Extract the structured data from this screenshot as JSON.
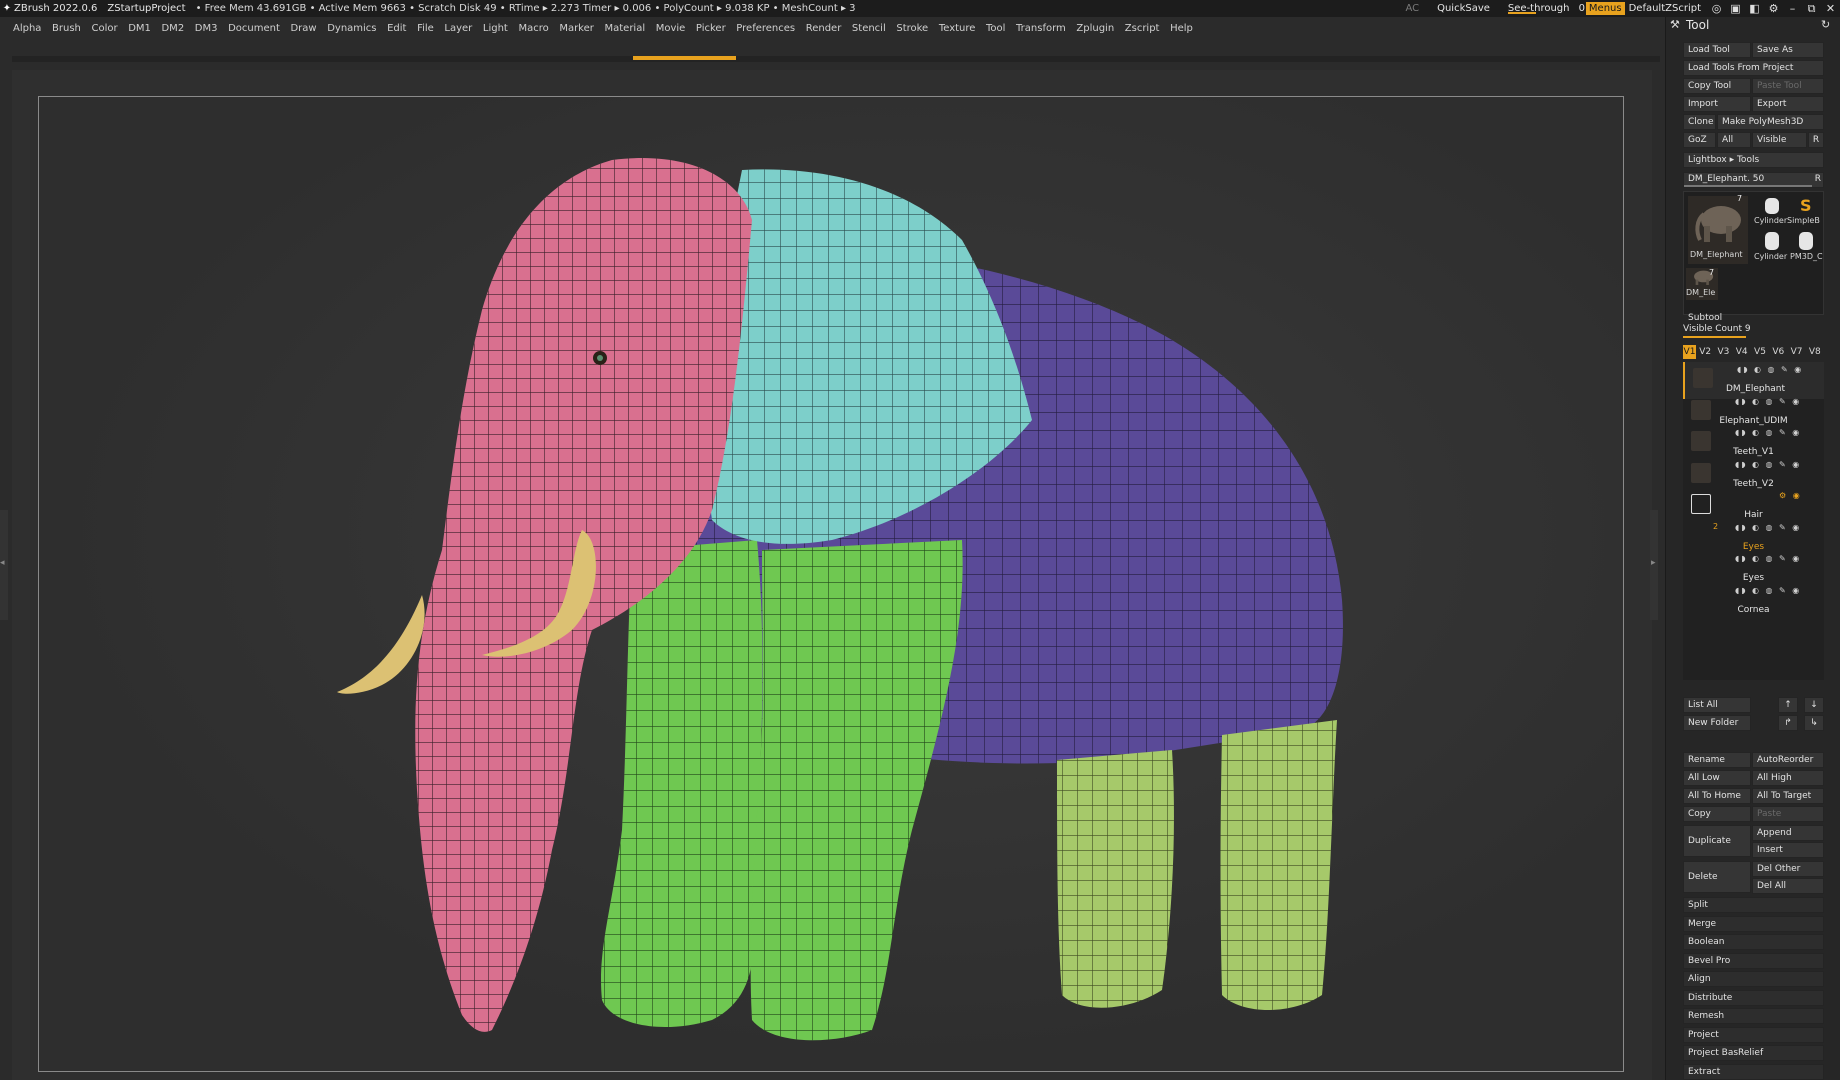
{
  "titlebar": {
    "app": "ZBrush 2022.0.6",
    "project": "ZStartupProject",
    "status": "• Free Mem 43.691GB • Active Mem 9663 • Scratch Disk 49 • RTime ▸ 2.273 Timer ▸ 0.006 • PolyCount ▸ 9.038 KP • MeshCount ▸ 3",
    "ac": "AC",
    "quicksave": "QuickSave",
    "see_through_label": "See-through",
    "see_through_value": "0",
    "menus": "Menus",
    "script": "DefaultZScript"
  },
  "menu": [
    "Alpha",
    "Brush",
    "Color",
    "DM1",
    "DM2",
    "DM3",
    "Document",
    "Draw",
    "Dynamics",
    "Edit",
    "File",
    "Layer",
    "Light",
    "Macro",
    "Marker",
    "Material",
    "Movie",
    "Picker",
    "Preferences",
    "Render",
    "Stencil",
    "Stroke",
    "Texture",
    "Tool",
    "Transform",
    "Zplugin",
    "Zscript",
    "Help"
  ],
  "tool_panel": {
    "title": "Tool",
    "load_tool": "Load Tool",
    "save_as": "Save As",
    "load_from_project": "Load Tools From Project",
    "copy_tool": "Copy Tool",
    "paste_tool": "Paste Tool",
    "import": "Import",
    "export": "Export",
    "clone": "Clone",
    "make_polymesh": "Make PolyMesh3D",
    "goz": "GoZ",
    "all": "All",
    "visible": "Visible",
    "r": "R",
    "lightbox_tools": "Lightbox ▸ Tools",
    "tool_slider": "DM_Elephant. 50",
    "tool_slider_level": 0.92,
    "thumbs": {
      "count_a": "7",
      "label_elephant": "DM_Elephant",
      "label_cyl1": "Cylinder",
      "label_simple": "SimpleB",
      "label_cyl2": "Cylinder",
      "label_pm3d": "PM3D_C",
      "count_b": "7",
      "label_small": "DM_Ele"
    },
    "subtool_title": "Subtool",
    "visible_count": "Visible Count 9",
    "visible_count_level": 0.45,
    "versions": [
      "V1",
      "V2",
      "V3",
      "V4",
      "V5",
      "V6",
      "V7",
      "V8"
    ],
    "subtools": [
      {
        "name": "DM_Elephant"
      },
      {
        "name": "Elephant_UDIM"
      },
      {
        "name": "Teeth_V1"
      },
      {
        "name": "Teeth_V2"
      },
      {
        "name": "Hair"
      },
      {
        "name": "Eyes",
        "folder_count": "2"
      },
      {
        "name": "Eyes"
      },
      {
        "name": "Cornea"
      }
    ],
    "list_all": "List All",
    "new_folder": "New Folder",
    "rename": "Rename",
    "autoreorder": "AutoReorder",
    "all_low": "All Low",
    "all_high": "All High",
    "all_to_home": "All To Home",
    "all_to_target": "All To Target",
    "copy": "Copy",
    "paste": "Paste",
    "duplicate": "Duplicate",
    "append": "Append",
    "insert": "Insert",
    "delete": "Delete",
    "del_other": "Del Other",
    "del_all": "Del All",
    "sections": [
      "Split",
      "Merge",
      "Boolean",
      "Bevel Pro",
      "Align",
      "Distribute",
      "Remesh",
      "Project",
      "Project BasRelief",
      "Extract"
    ]
  },
  "colors": {
    "accent": "#e8a21e",
    "head": "#d9708f",
    "ear": "#7dcfca",
    "body": "#5a4a98",
    "front_legs": "#6fc851",
    "back_legs": "#a6c96a",
    "tusks": "#dcc173"
  }
}
